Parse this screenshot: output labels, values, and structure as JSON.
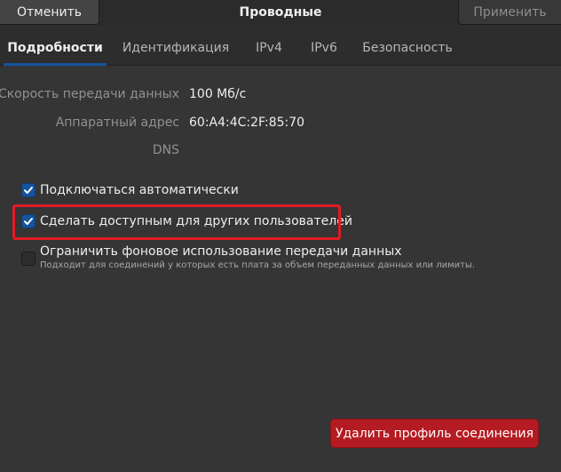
{
  "header": {
    "cancel_label": "Отменить",
    "title": "Проводные",
    "apply_label": "Применить"
  },
  "tabs": [
    {
      "label": "Подробности",
      "active": true
    },
    {
      "label": "Идентификация",
      "active": false
    },
    {
      "label": "IPv4",
      "active": false
    },
    {
      "label": "IPv6",
      "active": false
    },
    {
      "label": "Безопасность",
      "active": false
    }
  ],
  "details": {
    "speed": {
      "label": "Скорость передачи данных",
      "value": "100 Мб/с"
    },
    "hw_address": {
      "label": "Аппаратный адрес",
      "value": "60:A4:4C:2F:85:70"
    },
    "dns": {
      "label": "DNS"
    }
  },
  "options": {
    "auto_connect": {
      "label": "Подключаться автоматически",
      "checked": true
    },
    "available_to_all": {
      "label": "Сделать доступным для других пользователей",
      "checked": true
    },
    "metered": {
      "label": "Ограничить фоновое использование передачи данных",
      "hint": "Подходит для соединений у которых есть плата за объем переданных данных или лимиты.",
      "checked": false
    }
  },
  "footer": {
    "delete_label": "Удалить профиль соединения"
  },
  "colors": {
    "accent": "#15539e",
    "destructive": "#b51b22",
    "highlight": "#e01b24"
  }
}
